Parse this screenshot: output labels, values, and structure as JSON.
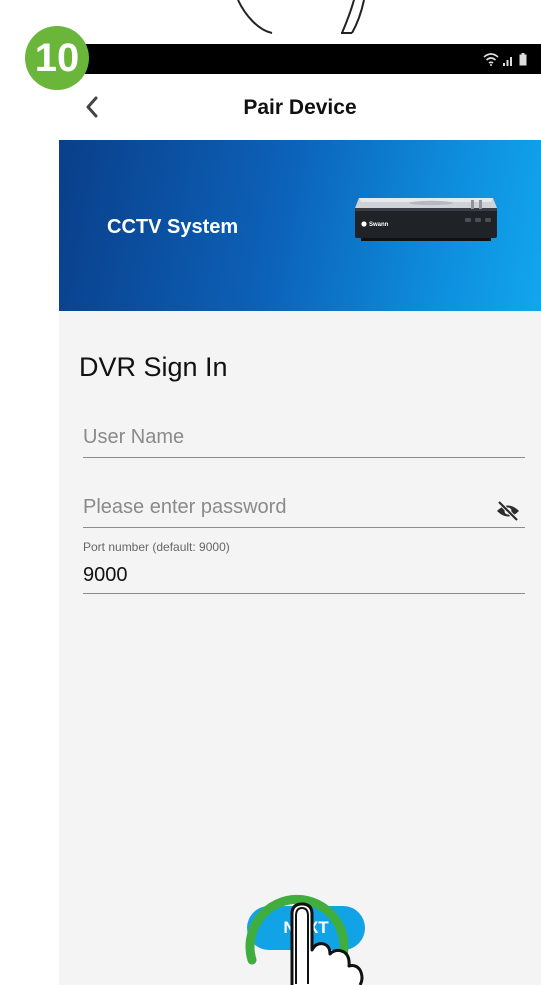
{
  "step_badge": "10",
  "nav": {
    "title": "Pair Device",
    "back_icon": "chevron-left-icon"
  },
  "banner": {
    "title": "CCTV System",
    "device_brand": "Swann"
  },
  "form": {
    "section_title": "DVR Sign In",
    "username_placeholder": "User Name",
    "password_placeholder": "Please enter password",
    "port_label": "Port number (default: 9000)",
    "port_value": "9000"
  },
  "next_button": {
    "label": "NEXT"
  },
  "colors": {
    "accent": "#12a3e6",
    "badge": "#6ab63a",
    "banner_dark": "#0a3f8a",
    "banner_light": "#12a6ee"
  }
}
